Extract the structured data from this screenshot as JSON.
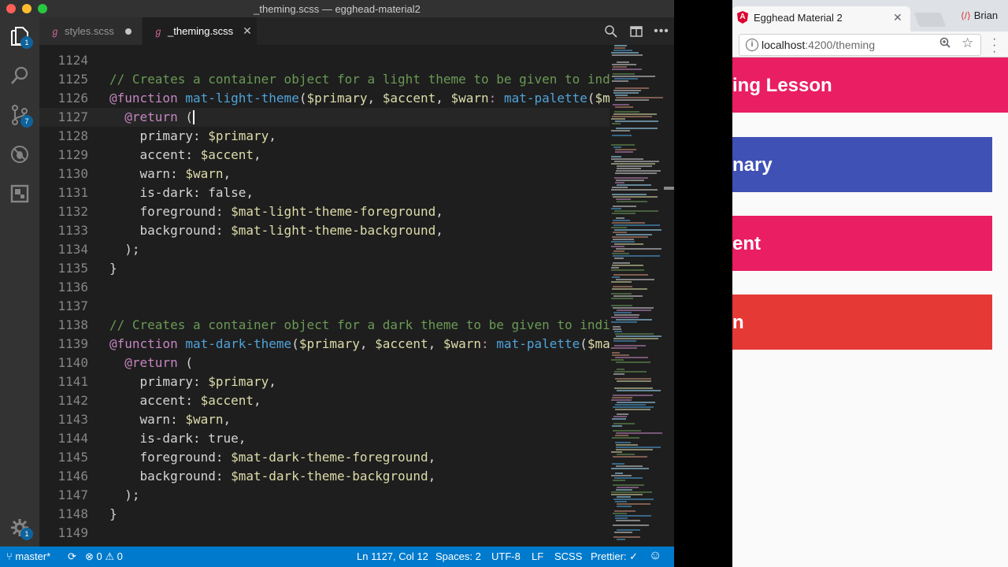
{
  "vscode": {
    "window_title": "_theming.scss — egghead-material2",
    "activity_badges": {
      "explorer": "1",
      "scm": "7",
      "settings": "1"
    },
    "tabs": [
      {
        "label": "styles.scss",
        "state": "modified"
      },
      {
        "label": "_theming.scss",
        "state": "active"
      }
    ],
    "code_lines": [
      {
        "n": "1124",
        "tokens": []
      },
      {
        "n": "1125",
        "tokens": [
          [
            "cm",
            "// Creates a container object for a light theme to be given to ind"
          ]
        ]
      },
      {
        "n": "1126",
        "tokens": [
          [
            "kw",
            "@function "
          ],
          [
            "fn",
            "mat-light-theme"
          ],
          [
            "pn",
            "("
          ],
          [
            "vr",
            "$primary"
          ],
          [
            "pn",
            ", "
          ],
          [
            "vr",
            "$accent"
          ],
          [
            "pn",
            ", "
          ],
          [
            "vr",
            "$warn"
          ],
          [
            "kw",
            ": "
          ],
          [
            "fn",
            "mat-palette"
          ],
          [
            "pn",
            "("
          ],
          [
            "vr",
            "$m"
          ]
        ]
      },
      {
        "n": "1127",
        "tokens": [
          [
            "pn",
            "  "
          ],
          [
            "kw",
            "@return "
          ],
          [
            "pn",
            "("
          ]
        ]
      },
      {
        "n": "1128",
        "tokens": [
          [
            "pn",
            "    primary: "
          ],
          [
            "vr",
            "$primary"
          ],
          [
            "pn",
            ","
          ]
        ]
      },
      {
        "n": "1129",
        "tokens": [
          [
            "pn",
            "    accent: "
          ],
          [
            "vr",
            "$accent"
          ],
          [
            "pn",
            ","
          ]
        ]
      },
      {
        "n": "1130",
        "tokens": [
          [
            "pn",
            "    warn: "
          ],
          [
            "vr",
            "$warn"
          ],
          [
            "pn",
            ","
          ]
        ]
      },
      {
        "n": "1131",
        "tokens": [
          [
            "pn",
            "    is-dark: false,"
          ]
        ]
      },
      {
        "n": "1132",
        "tokens": [
          [
            "pn",
            "    foreground: "
          ],
          [
            "vr",
            "$mat-light-theme-foreground"
          ],
          [
            "pn",
            ","
          ]
        ]
      },
      {
        "n": "1133",
        "tokens": [
          [
            "pn",
            "    background: "
          ],
          [
            "vr",
            "$mat-light-theme-background"
          ],
          [
            "pn",
            ","
          ]
        ]
      },
      {
        "n": "1134",
        "tokens": [
          [
            "pn",
            "  );"
          ]
        ]
      },
      {
        "n": "1135",
        "tokens": [
          [
            "pn",
            "}"
          ]
        ]
      },
      {
        "n": "1136",
        "tokens": []
      },
      {
        "n": "1137",
        "tokens": []
      },
      {
        "n": "1138",
        "tokens": [
          [
            "cm",
            "// Creates a container object for a dark theme to be given to indi"
          ]
        ]
      },
      {
        "n": "1139",
        "tokens": [
          [
            "kw",
            "@function "
          ],
          [
            "fn",
            "mat-dark-theme"
          ],
          [
            "pn",
            "("
          ],
          [
            "vr",
            "$primary"
          ],
          [
            "pn",
            ", "
          ],
          [
            "vr",
            "$accent"
          ],
          [
            "pn",
            ", "
          ],
          [
            "vr",
            "$warn"
          ],
          [
            "kw",
            ": "
          ],
          [
            "fn",
            "mat-palette"
          ],
          [
            "pn",
            "("
          ],
          [
            "vr",
            "$ma"
          ]
        ]
      },
      {
        "n": "1140",
        "tokens": [
          [
            "pn",
            "  "
          ],
          [
            "kw",
            "@return "
          ],
          [
            "pn",
            "("
          ]
        ]
      },
      {
        "n": "1141",
        "tokens": [
          [
            "pn",
            "    primary: "
          ],
          [
            "vr",
            "$primary"
          ],
          [
            "pn",
            ","
          ]
        ]
      },
      {
        "n": "1142",
        "tokens": [
          [
            "pn",
            "    accent: "
          ],
          [
            "vr",
            "$accent"
          ],
          [
            "pn",
            ","
          ]
        ]
      },
      {
        "n": "1143",
        "tokens": [
          [
            "pn",
            "    warn: "
          ],
          [
            "vr",
            "$warn"
          ],
          [
            "pn",
            ","
          ]
        ]
      },
      {
        "n": "1144",
        "tokens": [
          [
            "pn",
            "    is-dark: true,"
          ]
        ]
      },
      {
        "n": "1145",
        "tokens": [
          [
            "pn",
            "    foreground: "
          ],
          [
            "vr",
            "$mat-dark-theme-foreground"
          ],
          [
            "pn",
            ","
          ]
        ]
      },
      {
        "n": "1146",
        "tokens": [
          [
            "pn",
            "    background: "
          ],
          [
            "vr",
            "$mat-dark-theme-background"
          ],
          [
            "pn",
            ","
          ]
        ]
      },
      {
        "n": "1147",
        "tokens": [
          [
            "pn",
            "  );"
          ]
        ]
      },
      {
        "n": "1148",
        "tokens": [
          [
            "pn",
            "}"
          ]
        ]
      },
      {
        "n": "1149",
        "tokens": []
      }
    ],
    "status": {
      "branch": "master*",
      "errors": "0",
      "warnings": "0",
      "position": "Ln 1127, Col 12",
      "spaces": "Spaces: 2",
      "encoding": "UTF-8",
      "eol": "LF",
      "language": "SCSS",
      "prettier": "Prettier: ✓"
    }
  },
  "chrome": {
    "tab_title": "Egghead Material 2",
    "user": "Brian",
    "url_host": "localhost",
    "url_path": ":4200/theming",
    "page": {
      "title": "ing Lesson",
      "buttons": [
        {
          "label": "nary",
          "color": "#3f51b5"
        },
        {
          "label": "ent",
          "color": "#e91e63"
        },
        {
          "label": "n",
          "color": "#e53935"
        }
      ]
    }
  },
  "colors": {
    "status_bar": "#007acc",
    "page_header": "#e91e63",
    "primary": "#3f51b5",
    "accent": "#e91e63",
    "warn": "#e53935"
  }
}
